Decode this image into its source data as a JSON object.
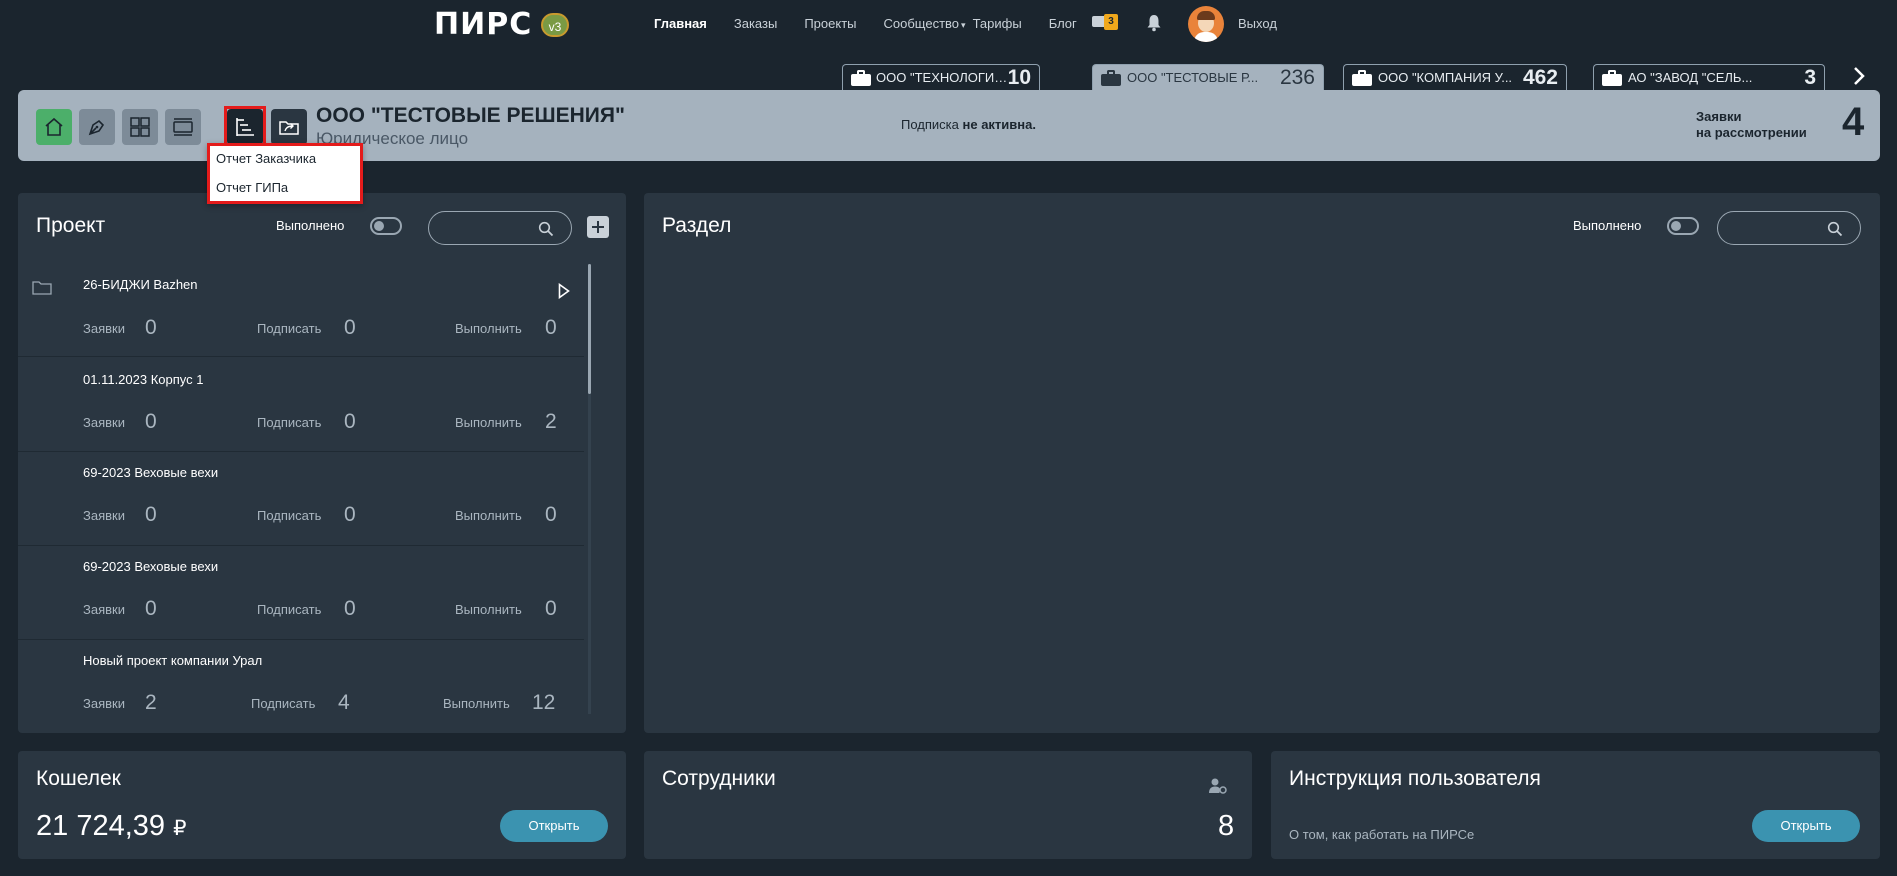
{
  "nav": {
    "logo": "ПИРС",
    "version": "v3",
    "links": [
      "Главная",
      "Заказы",
      "Проекты",
      "Сообщество",
      "Тарифы",
      "Блог"
    ],
    "chat_badge": "3",
    "logout": "Выход"
  },
  "company_tabs": [
    {
      "name": "ООО \"ТЕХНОЛОГИЯ...",
      "count": "10"
    },
    {
      "name": "ООО \"ТЕСТОВЫЕ Р...",
      "count": "236"
    },
    {
      "name": "ООО \"КОМПАНИЯ У...",
      "count": "462"
    },
    {
      "name": "АО \"ЗАВОД \"СЕЛЬ...",
      "count": "3"
    }
  ],
  "company": {
    "name": "ООО \"ТЕСТОВЫЕ РЕШЕНИЯ\"",
    "type": "Юридическое лицо",
    "subscription_prefix": "Подписка ",
    "subscription_status": "не активна.",
    "requests_label_1": "Заявки",
    "requests_label_2": "на рассмотрении",
    "requests_count": "4"
  },
  "dropdown": {
    "item1": "Отчет Заказчика",
    "item2": "Отчет ГИПа"
  },
  "project_panel": {
    "title": "Проект",
    "toggle_label": "Выполнено",
    "projects": [
      {
        "name": "26-БИДЖИ Bazhen",
        "requests_label": "Заявки",
        "requests": "0",
        "sign_label": "Подписать",
        "sign": "0",
        "do_label": "Выполнить",
        "do": "0"
      },
      {
        "name": "01.11.2023 Корпус 1",
        "requests_label": "Заявки",
        "requests": "0",
        "sign_label": "Подписать",
        "sign": "0",
        "do_label": "Выполнить",
        "do": "2"
      },
      {
        "name": "69-2023 Веховые вехи",
        "requests_label": "Заявки",
        "requests": "0",
        "sign_label": "Подписать",
        "sign": "0",
        "do_label": "Выполнить",
        "do": "0"
      },
      {
        "name": "69-2023 Веховые вехи",
        "requests_label": "Заявки",
        "requests": "0",
        "sign_label": "Подписать",
        "sign": "0",
        "do_label": "Выполнить",
        "do": "0"
      },
      {
        "name": "Новый проект компании Урал",
        "requests_label": "Заявки",
        "requests": "2",
        "sign_label": "Подписать",
        "sign": "4",
        "do_label": "Выполнить",
        "do": "12"
      }
    ]
  },
  "section_panel": {
    "title": "Раздел",
    "toggle_label": "Выполнено"
  },
  "wallet": {
    "title": "Кошелек",
    "amount": "21 724,39",
    "currency": "₽",
    "button": "Открыть"
  },
  "staff": {
    "title": "Сотрудники",
    "count": "8"
  },
  "manual": {
    "title": "Инструкция пользователя",
    "desc": "О том, как работать на ПИРСе",
    "button": "Открыть"
  },
  "colors": {
    "background": "#1b252e",
    "panel": "#2a3641",
    "accent": "#3b93b0",
    "home_button": "#4caf6a",
    "highlight": "#e41b1b",
    "badge": "#f0a81c"
  }
}
